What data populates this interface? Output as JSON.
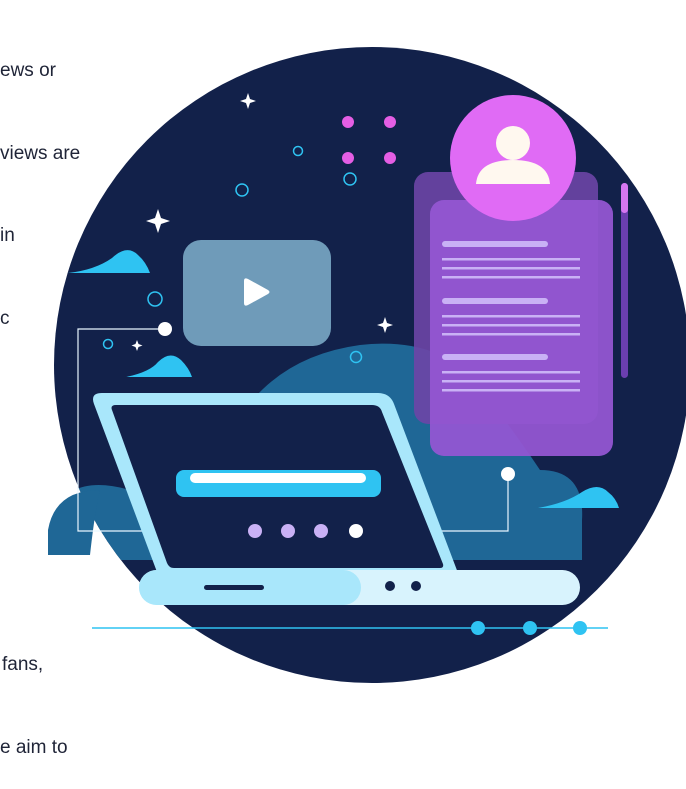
{
  "text_top": [
    "ews or",
    "views are",
    "in",
    "c"
  ],
  "text_bottom": [
    "fans,",
    "e aim to"
  ],
  "colors": {
    "circle_bg": "#12214a",
    "cloud_blue": "#1f6796",
    "sky_cyan": "#2fc3f2",
    "laptop_outline": "#a9e7fb",
    "video_card": "#6f9bb9",
    "profile_purple": "#9b4fd1",
    "avatar_pink": "#e06bf5",
    "lavender": "#c9b1f5",
    "pink_dot": "#e45ee4"
  },
  "icons": [
    "play-icon",
    "user-avatar-icon",
    "sparkle-icon"
  ]
}
